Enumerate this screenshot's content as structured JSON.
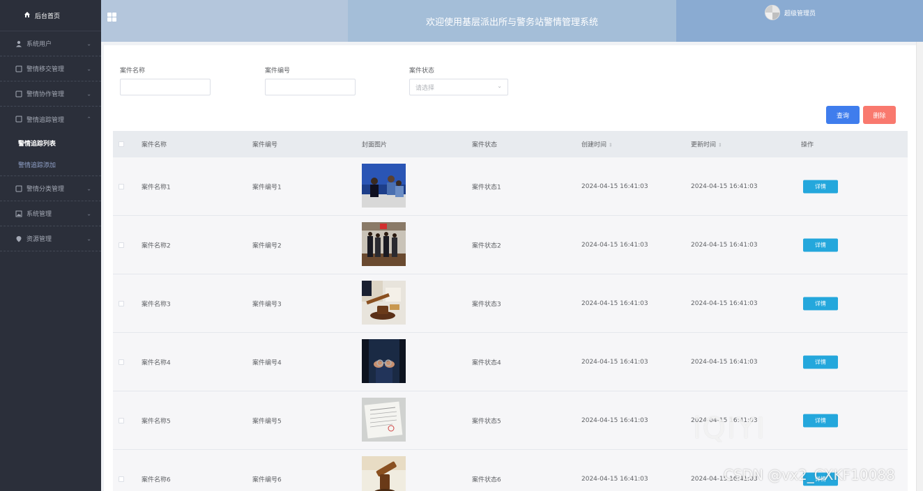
{
  "header": {
    "title": "欢迎使用基层派出所与警务站警情管理系统",
    "user_name": "超级管理员"
  },
  "sidebar": {
    "home_label": "后台首页",
    "items": [
      {
        "label": "系统用户",
        "icon": "user-icon"
      },
      {
        "label": "警情移交管理",
        "icon": "doc-icon"
      },
      {
        "label": "警情协作管理",
        "icon": "doc-icon"
      },
      {
        "label": "警情追踪管理",
        "icon": "doc-icon",
        "expanded": true
      },
      {
        "label": "警情分类管理",
        "icon": "doc-icon"
      },
      {
        "label": "系统管理",
        "icon": "image-icon"
      },
      {
        "label": "资源管理",
        "icon": "location-icon"
      }
    ],
    "subitems": [
      {
        "label": "警情追踪列表",
        "active": true
      },
      {
        "label": "警情追踪添加",
        "active": false
      }
    ]
  },
  "search": {
    "case_name_label": "案件名称",
    "case_no_label": "案件编号",
    "case_status_label": "案件状态",
    "status_placeholder": "请选择"
  },
  "actions": {
    "query_label": "查询",
    "delete_label": "删除"
  },
  "table": {
    "columns": [
      "案件名称",
      "案件编号",
      "封面图片",
      "案件状态",
      "创建时间",
      "更新时间",
      "操作"
    ],
    "detail_label": "详情",
    "rows": [
      {
        "name": "案件名称1",
        "no": "案件编号1",
        "status": "案件状态1",
        "created": "2024-04-15 16:41:03",
        "updated": "2024-04-15 16:41:03",
        "image": "police-interview-photo"
      },
      {
        "name": "案件名称2",
        "no": "案件编号2",
        "status": "案件状态2",
        "created": "2024-04-15 16:41:03",
        "updated": "2024-04-15 16:41:03",
        "image": "courtroom-photo"
      },
      {
        "name": "案件名称3",
        "no": "案件编号3",
        "status": "案件状态3",
        "created": "2024-04-15 16:41:03",
        "updated": "2024-04-15 16:41:03",
        "image": "gavel-photo"
      },
      {
        "name": "案件名称4",
        "no": "案件编号4",
        "status": "案件状态4",
        "created": "2024-04-15 16:41:03",
        "updated": "2024-04-15 16:41:03",
        "image": "handcuffs-photo"
      },
      {
        "name": "案件名称5",
        "no": "案件编号5",
        "status": "案件状态5",
        "created": "2024-04-15 16:41:03",
        "updated": "2024-04-15 16:41:03",
        "image": "document-photo"
      },
      {
        "name": "案件名称6",
        "no": "案件编号6",
        "status": "案件状态6",
        "created": "2024-04-15 16:41:03",
        "updated": "2024-04-15 16:41:03",
        "image": "gavel-closeup-photo"
      }
    ]
  },
  "watermarks": {
    "logo_text": "iQIYI",
    "csdn_text": "CSDN @vx2_CXKF10088"
  }
}
